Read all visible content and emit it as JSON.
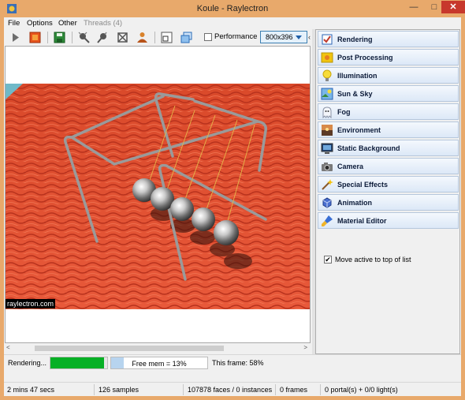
{
  "window": {
    "title": "Koule - Raylectron",
    "minimize_glyph": "—",
    "maximize_glyph": "□",
    "close_glyph": "✕"
  },
  "menu": [
    {
      "label": "File",
      "enabled": true
    },
    {
      "label": "Options",
      "enabled": true
    },
    {
      "label": "Other",
      "enabled": true
    },
    {
      "label": "Threads (4)",
      "enabled": false
    }
  ],
  "toolbar": {
    "buttons": [
      "play-icon",
      "stop-render-icon",
      "save-icon",
      "light-tool-icon",
      "light-tool-2-icon",
      "material-tool-icon",
      "person-icon",
      "zoom-window-icon",
      "copy-window-icon"
    ],
    "performance_label": "Performance mode",
    "resolution": "800x396",
    "overflow_glyph": "‹"
  },
  "viewport": {
    "watermark": "raylectron.com",
    "scroll_left": "<",
    "scroll_right": ">"
  },
  "side_panel": {
    "items": [
      {
        "label": "Rendering",
        "icon": "rendering-icon"
      },
      {
        "label": "Post Processing",
        "icon": "post-processing-icon"
      },
      {
        "label": "Illumination",
        "icon": "lightbulb-icon"
      },
      {
        "label": "Sun & Sky",
        "icon": "sun-sky-icon"
      },
      {
        "label": "Fog",
        "icon": "fog-ghost-icon"
      },
      {
        "label": "Environment",
        "icon": "environment-icon"
      },
      {
        "label": "Static Background",
        "icon": "monitor-icon"
      },
      {
        "label": "Camera",
        "icon": "camera-icon"
      },
      {
        "label": "Special Effects",
        "icon": "special-effects-icon"
      },
      {
        "label": "Animation",
        "icon": "animation-icon"
      },
      {
        "label": "Material Editor",
        "icon": "brush-icon"
      }
    ],
    "move_active_label": "Move active to top of list",
    "move_active_checked": true,
    "check_glyph": "✔"
  },
  "progress": {
    "status": "Rendering...",
    "render_progress": 0.95,
    "memory_fraction": 0.13,
    "free_mem": "Free mem = 13%",
    "this_frame": "This frame: 58%"
  },
  "statusbar": {
    "elapsed": "2 mins  47 secs",
    "samples": "126 samples",
    "faces": "107878 faces / 0 instances",
    "frames": "0 frames",
    "portals": "0 portal(s)  +  0/0 light(s)"
  },
  "colors": {
    "titlebar": "#e8a96b",
    "progress_green": "#06b025",
    "close_red": "#c7382c"
  }
}
